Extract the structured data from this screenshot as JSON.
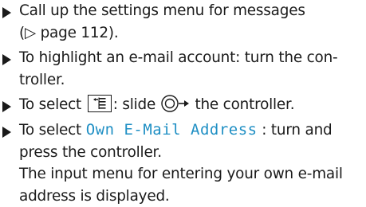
{
  "steps": [
    {
      "text1": "Call up the settings menu for messages",
      "text2": "(▷ page 112)."
    },
    {
      "text1": "To highlight an e-mail account: turn the con-",
      "text2": "troller."
    },
    {
      "before": "To select",
      "between": ": slide",
      "after": "the controller.",
      "key_icon": "menu-key-icon",
      "controller_icon": "controller-slide-right-icon"
    },
    {
      "before": "To select",
      "code": "Own E-Mail Address",
      "after": ": turn and",
      "line2": "press the controller.",
      "result1": "The input menu for entering your own e-mail",
      "result2": "address is displayed."
    }
  ]
}
